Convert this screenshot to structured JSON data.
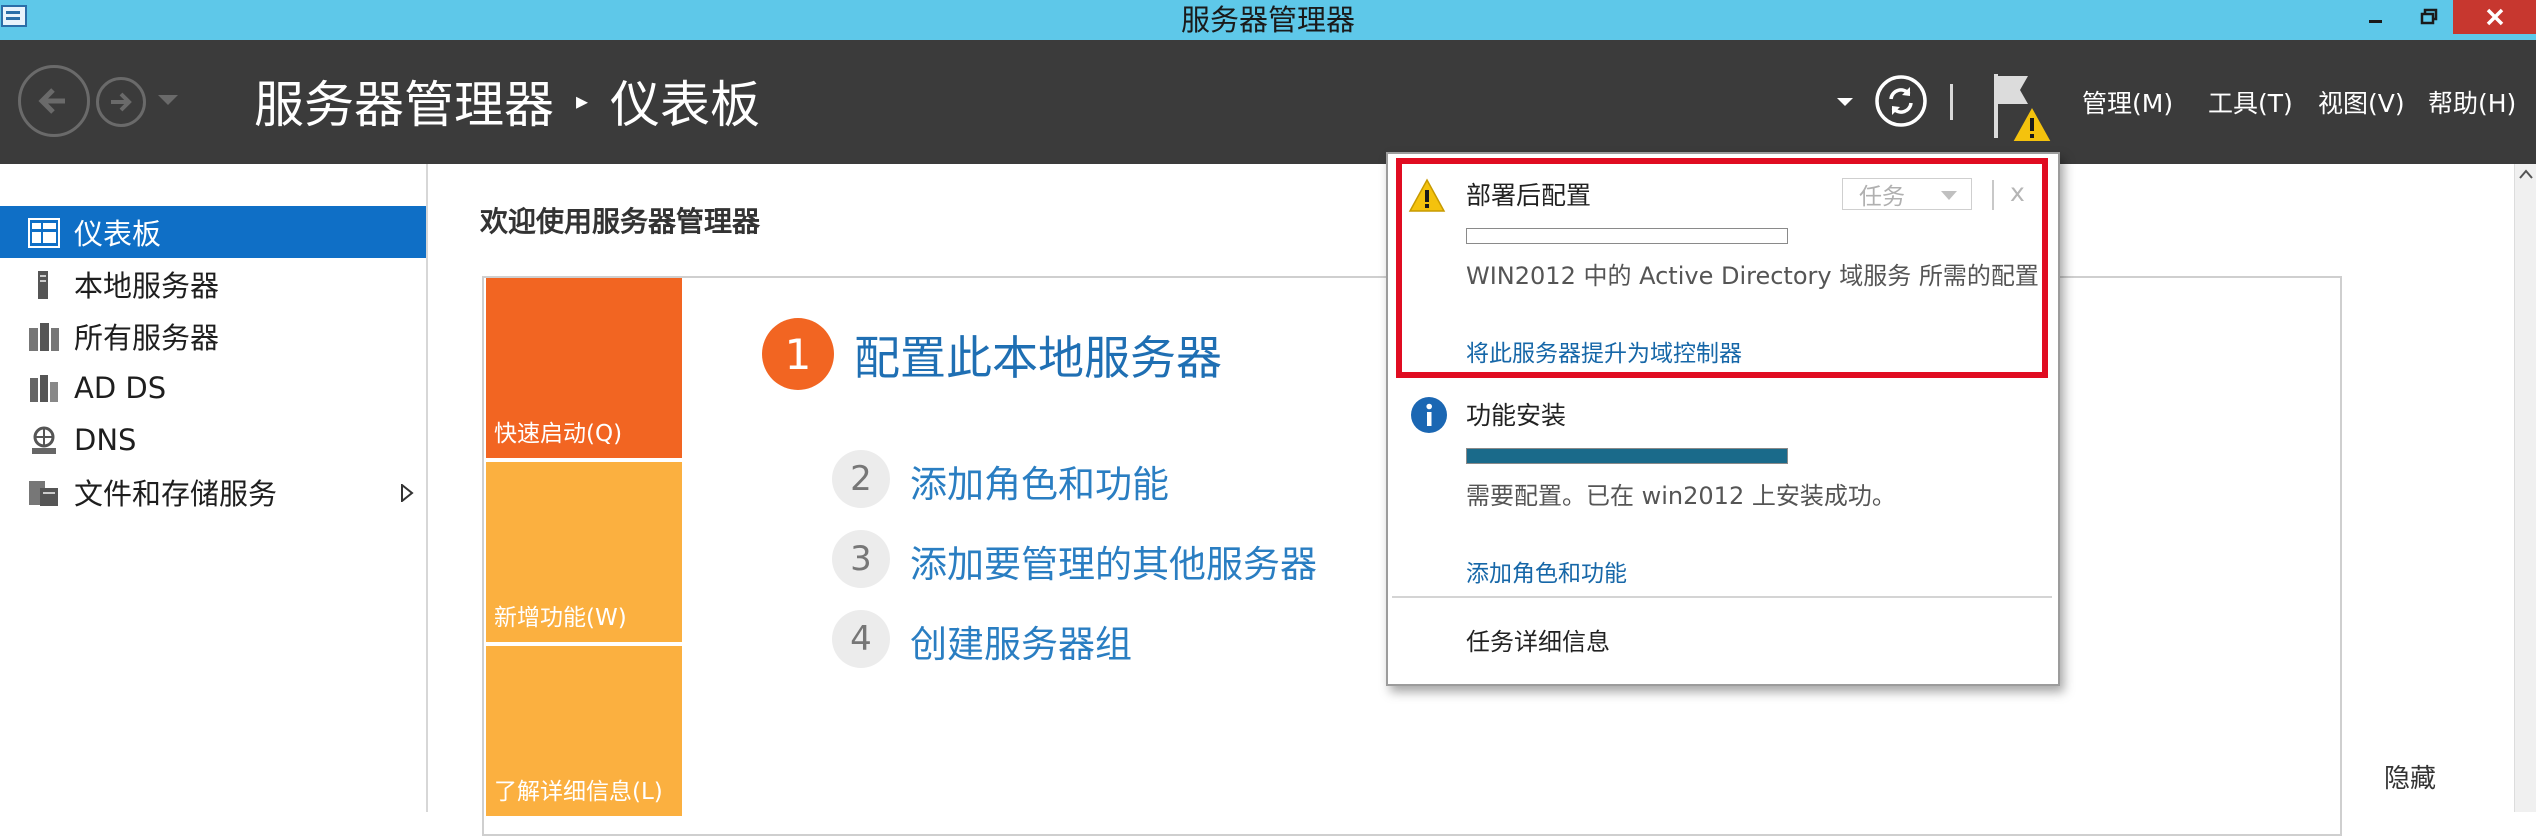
{
  "window": {
    "title": "服务器管理器"
  },
  "header": {
    "breadcrumb_root": "服务器管理器",
    "breadcrumb_page": "仪表板",
    "menus": [
      "管理(M)",
      "工具(T)",
      "视图(V)",
      "帮助(H)"
    ]
  },
  "sidebar": {
    "items": [
      {
        "label": "仪表板",
        "icon": "dashboard-icon",
        "selected": true
      },
      {
        "label": "本地服务器",
        "icon": "server-icon"
      },
      {
        "label": "所有服务器",
        "icon": "servers-icon"
      },
      {
        "label": "AD DS",
        "icon": "ad-ds-icon"
      },
      {
        "label": "DNS",
        "icon": "dns-icon"
      },
      {
        "label": "文件和存储服务",
        "icon": "file-storage-icon",
        "has_children": true
      }
    ]
  },
  "main": {
    "welcome": "欢迎使用服务器管理器",
    "tiles": [
      "快速启动(Q)",
      "新增功能(W)",
      "了解详细信息(L)"
    ],
    "steps": [
      {
        "num": "1",
        "label": "配置此本地服务器"
      },
      {
        "num": "2",
        "label": "添加角色和功能"
      },
      {
        "num": "3",
        "label": "添加要管理的其他服务器"
      },
      {
        "num": "4",
        "label": "创建服务器组"
      }
    ],
    "hide": "隐藏"
  },
  "notifications": {
    "post_deploy": {
      "title": "部署后配置",
      "task_button": "任务",
      "dismiss": "x",
      "description": "WIN2012 中的 Active Directory 域服务 所需的配置",
      "link": "将此服务器提升为域控制器",
      "progress": 0.0
    },
    "feature_install": {
      "title": "功能安装",
      "description": "需要配置。已在 win2012 上安装成功。",
      "link": "添加角色和功能",
      "progress": 1.0
    },
    "task_details": "任务详细信息"
  },
  "colors": {
    "title_bar": "#5ec8e9",
    "header": "#3b3b3b",
    "selected": "#0f6fc6",
    "tile_primary": "#f26522",
    "tile_secondary": "#fbb040",
    "highlight": "#e00c21",
    "progress": "#1a6a8a"
  }
}
